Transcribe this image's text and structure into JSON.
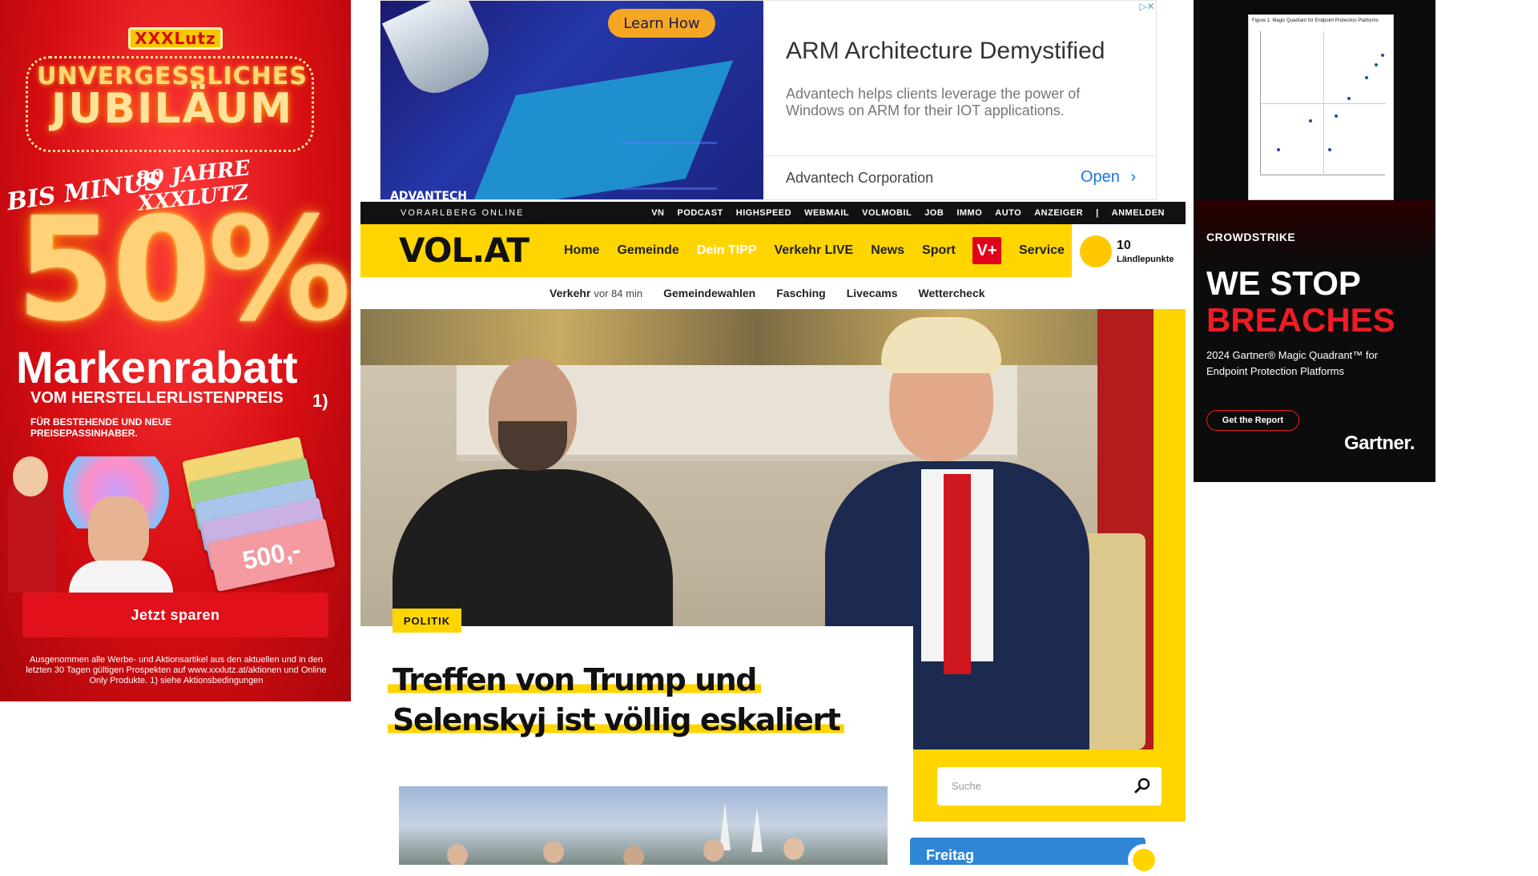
{
  "ads": {
    "left": {
      "logo": "XXXLutz",
      "headline_1": "UNVERGESSLICHES",
      "headline_2": "JUBILÄUM",
      "years": "80 JAHRE XXXLUTZ",
      "bis_minus": "BIS MINUS",
      "percent": "50%",
      "rabatt": "Markenrabatt",
      "vom": "VOM HERSTELLERLISTENPREIS",
      "footnote_mark": "1)",
      "fuer": "FÜR BESTEHENDE UND NEUE PREISEPASSINHABER.",
      "voucher_value": "500,-",
      "cta": "Jetzt sparen",
      "fine_print": "Ausgenommen alle Werbe- und Aktionsartikel aus den aktuellen und in den letzten 30 Tagen gültigen Prospekten auf www.xxxlutz.at/aktionen und Online Only Produkte. 1) siehe Aktionsbedingungen",
      "brand_color": "#d60d12"
    },
    "top": {
      "learn_how": "Learn How",
      "image_brand": "ADVANTECH",
      "title": "ARM Architecture Demystified",
      "description": "Advantech helps clients leverage the power of Windows on ARM for their IOT applications.",
      "advertiser": "Advantech Corporation",
      "open_label": "Open",
      "adchoices_icon": "adchoices-icon"
    },
    "right": {
      "chart_caption": "Figure 1: Magic Quadrant for Endpoint Protection Platforms",
      "logo": "CROWDSTRIKE",
      "headline_1": "WE STOP",
      "headline_2": "BREACHES",
      "subtitle": "2024 Gartner® Magic Quadrant™ for Endpoint Protection Platforms",
      "cta": "Get the Report",
      "brand": "Gartner.",
      "accent_color": "#ee1c25"
    }
  },
  "site": {
    "topbar": {
      "brand": "VORARLBERG ONLINE",
      "links": [
        "VN",
        "PODCAST",
        "HIGHSPEED",
        "WEBMAIL",
        "VOLMOBIL",
        "JOB",
        "IMMO",
        "AUTO",
        "ANZEIGER",
        "|",
        "ANMELDEN"
      ]
    },
    "nav": {
      "logo": "VOL.AT",
      "items": [
        "Home",
        "Gemeinde",
        "Dein TIPP",
        "Verkehr LIVE",
        "News",
        "Sport"
      ],
      "vplus": "V+",
      "service": "Service",
      "points_value": "10",
      "points_label": "Ländlepunkte",
      "brand_color": "#ffd500"
    },
    "subnav": {
      "verkehr": "Verkehr",
      "verkehr_time": "vor 84 min",
      "items": [
        "Gemeindewahlen",
        "Fasching",
        "Livecams",
        "Wettercheck"
      ]
    },
    "hero": {
      "category": "POLITIK",
      "headline_line1": "Treffen von Trump und",
      "headline_line2": "Selenskyj ist völlig eskaliert",
      "image_icon": "news-photo"
    },
    "search": {
      "placeholder": "Suche",
      "icon": "search-icon"
    },
    "weather": {
      "day": "Freitag"
    }
  }
}
